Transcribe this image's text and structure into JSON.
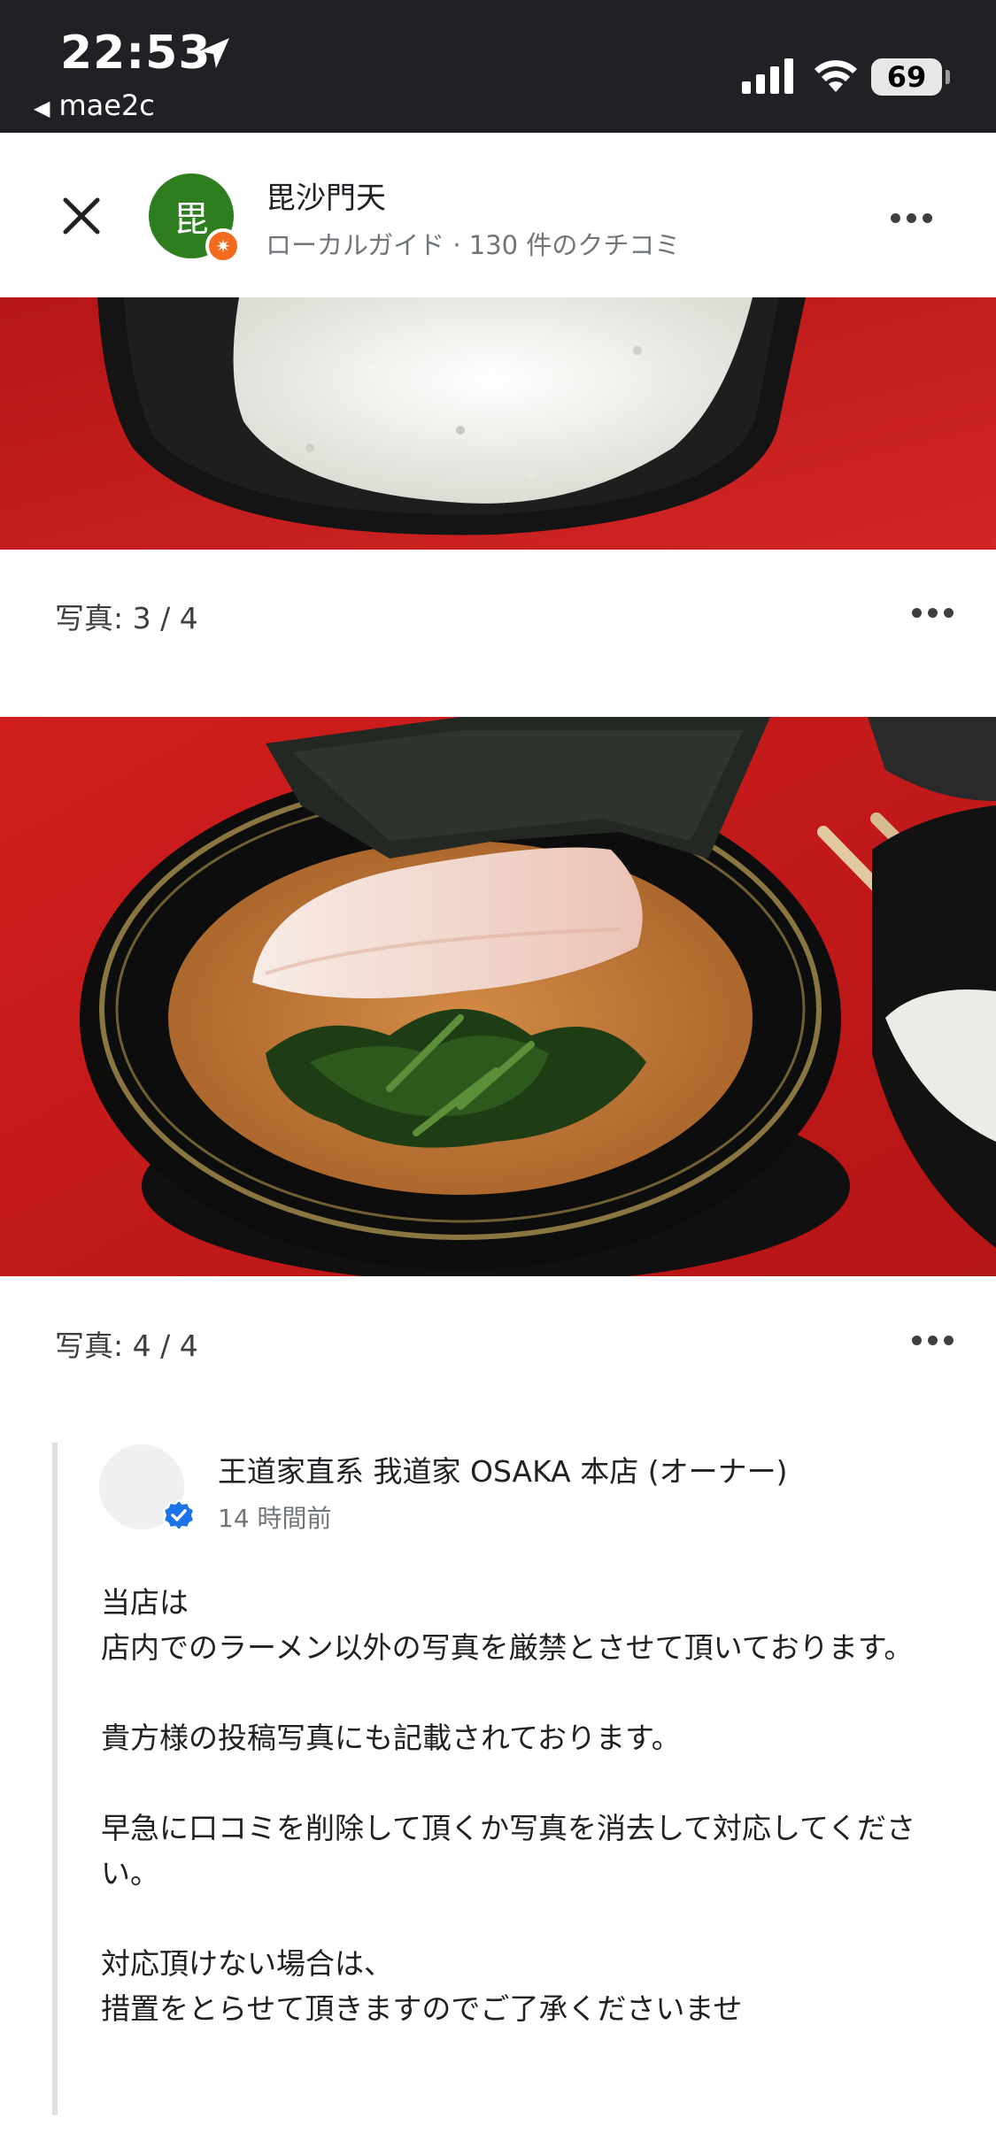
{
  "status_bar": {
    "time": "22:53",
    "back_app": "mae2c",
    "battery": "69",
    "icons": [
      "location-arrow-icon",
      "cellular-signal-icon",
      "wifi-icon",
      "battery-icon"
    ]
  },
  "header": {
    "avatar_letter": "毘",
    "avatar_color": "#2e7d1e",
    "badge_icon": "local-guide-star-icon",
    "reviewer_name": "毘沙門天",
    "reviewer_meta": "ローカルガイド · 130 件のクチコミ",
    "close_icon": "close-icon",
    "menu_icon": "more-horizontal-icon"
  },
  "photos": [
    {
      "caption": "写真: 3 / 4",
      "subject": "rice-bowl"
    },
    {
      "caption": "写真: 4 / 4",
      "subject": "ramen-bowl"
    }
  ],
  "owner_reply": {
    "name": "王道家直系 我道家 OSAKA 本店 (オーナー)",
    "time": "14 時間前",
    "verified_icon": "verified-check-icon",
    "paragraphs": [
      "当店は",
      "店内でのラーメン以外の写真を厳禁とさせて頂いております。",
      "",
      "貴方様の投稿写真にも記載されております。",
      "",
      "早急に口コミを削除して頂くか写真を消去して対応してください。",
      "",
      "対応頂けない場合は、",
      "措置をとらせて頂きますのでご了承くださいませ"
    ]
  },
  "colors": {
    "status_bar_bg": "#202124",
    "table_red": "#c81e1e",
    "verified_blue": "#1a73e8"
  }
}
